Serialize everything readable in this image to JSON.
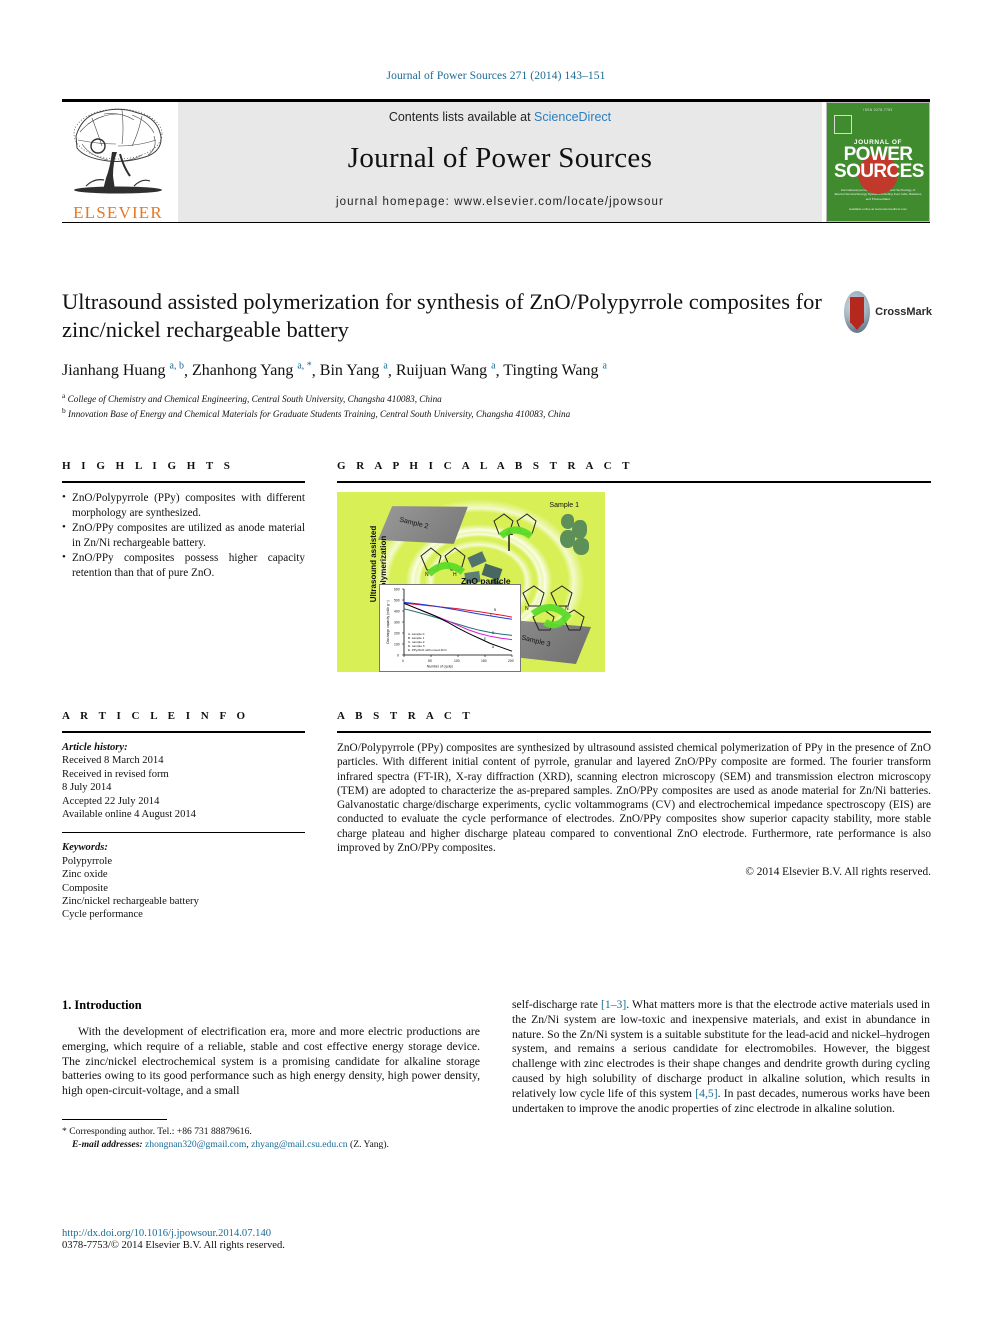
{
  "running_head": "Journal of Power Sources 271 (2014) 143–151",
  "masthead": {
    "contents_prefix": "Contents lists available at ",
    "sciencedirect": "ScienceDirect",
    "journal_name": "Journal of Power Sources",
    "homepage": "journal homepage: www.elsevier.com/locate/jpowsour",
    "publisher_logo_text": "ELSEVIER",
    "cover": {
      "top_line": "ISSN 0378-7753",
      "journal_of": "JOURNAL OF",
      "word1": "POWER",
      "word2": "SOURCES",
      "blurb": "International journal on the Science and Technology of Electrochemical Energy Systems including Fuel Cells, Batteries and Photovoltaics",
      "bottom": "Available online at www.sciencedirect.com"
    }
  },
  "article": {
    "title": "Ultrasound assisted polymerization for synthesis of ZnO/Polypyrrole composites for zinc/nickel rechargeable battery",
    "crossmark_label": "CrossMark",
    "authors": [
      {
        "name": "Jianhang Huang",
        "marks": "a, b"
      },
      {
        "name": "Zhanhong Yang",
        "marks": "a, *"
      },
      {
        "name": "Bin Yang",
        "marks": "a"
      },
      {
        "name": "Ruijuan Wang",
        "marks": "a"
      },
      {
        "name": "Tingting Wang",
        "marks": "a"
      }
    ],
    "affiliations": [
      {
        "mark": "a",
        "text": "College of Chemistry and Chemical Engineering, Central South University, Changsha 410083, China"
      },
      {
        "mark": "b",
        "text": "Innovation Base of Energy and Chemical Materials for Graduate Students Training, Central South University, Changsha 410083, China"
      }
    ]
  },
  "highlights": {
    "heading": "H I G H L I G H T S",
    "items": [
      "ZnO/Polypyrrole (PPy) composites with different morphology are synthesized.",
      "ZnO/PPy composites are utilized as anode material in Zn/Ni rechargeable battery.",
      "ZnO/PPy composites possess higher capacity retention than that of pure ZnO."
    ]
  },
  "graphical_abstract": {
    "heading": "G R A P H I C A L  A B S T R A C T",
    "figure_labels": {
      "vertical": "Ultrasound assisted polymerization",
      "sample1": "Sample 1",
      "sample2": "Sample 2",
      "sample3": "Sample 3",
      "zno": "ZnO particle"
    }
  },
  "chart_data": {
    "type": "line",
    "title": "",
    "xlabel": "Number of cycles",
    "ylabel": "Discharge capacity (mAh g⁻¹)",
    "xlim": [
      0,
      200
    ],
    "ylim": [
      0,
      600
    ],
    "xticks": [
      0,
      50,
      100,
      150,
      200
    ],
    "yticks": [
      0,
      100,
      200,
      300,
      400,
      500,
      600
    ],
    "grid": false,
    "legend_position": "lower-left",
    "legend": [
      {
        "key": "A",
        "label": "sample 0",
        "color": "#000000"
      },
      {
        "key": "B",
        "label": "sample 1",
        "color": "#e8112d"
      },
      {
        "key": "C",
        "label": "sample 2",
        "color": "#1a3fd0"
      },
      {
        "key": "D",
        "label": "sample 3",
        "color": "#1f6f6f"
      },
      {
        "key": "E",
        "label": "PPy/ZnO with mixed ZnO",
        "color": "#d81bd8"
      }
    ],
    "series": [
      {
        "name": "sample 0",
        "color": "#000000",
        "x": [
          0,
          20,
          40,
          60,
          80,
          100,
          120,
          140,
          160,
          180,
          200
        ],
        "values": [
          470,
          430,
          390,
          350,
          300,
          245,
          195,
          150,
          105,
          70,
          35
        ]
      },
      {
        "name": "sample 1",
        "color": "#e8112d",
        "x": [
          0,
          20,
          40,
          60,
          80,
          100,
          120,
          140,
          160,
          180,
          200
        ],
        "values": [
          495,
          488,
          478,
          468,
          458,
          447,
          433,
          420,
          405,
          390,
          372
        ]
      },
      {
        "name": "sample 2",
        "color": "#1a3fd0",
        "x": [
          0,
          20,
          40,
          60,
          80,
          100,
          120,
          140,
          160,
          180,
          200
        ],
        "values": [
          478,
          468,
          455,
          442,
          425,
          408,
          390,
          372,
          355,
          340,
          325
        ]
      },
      {
        "name": "sample 3",
        "color": "#1f6f6f",
        "x": [
          0,
          20,
          40,
          60,
          80,
          100,
          120,
          140,
          160,
          180,
          200
        ],
        "values": [
          420,
          395,
          368,
          340,
          310,
          280,
          250,
          225,
          205,
          190,
          178
        ]
      },
      {
        "name": "PPy/ZnO with mixed ZnO",
        "color": "#d81bd8",
        "x": [
          0,
          20,
          40,
          60,
          80,
          100,
          120,
          140,
          160,
          180,
          200
        ],
        "values": [
          470,
          430,
          392,
          352,
          312,
          270,
          228,
          195,
          170,
          152,
          140
        ]
      }
    ]
  },
  "article_info": {
    "heading": "A R T I C L E  I N F O",
    "history_label": "Article history:",
    "history": [
      "Received 8 March 2014",
      "Received in revised form",
      "8 July 2014",
      "Accepted 22 July 2014",
      "Available online 4 August 2014"
    ],
    "keywords_label": "Keywords:",
    "keywords": [
      "Polypyrrole",
      "Zinc oxide",
      "Composite",
      "Zinc/nickel rechargeable battery",
      "Cycle performance"
    ]
  },
  "abstract": {
    "heading": "A B S T R A C T",
    "text": "ZnO/Polypyrrole (PPy) composites are synthesized by ultrasound assisted chemical polymerization of PPy in the presence of ZnO particles. With different initial content of pyrrole, granular and layered ZnO/PPy composite are formed. The fourier transform infrared spectra (FT-IR), X-ray diffraction (XRD), scanning electron microscopy (SEM) and transmission electron microscopy (TEM) are adopted to characterize the as-prepared samples. ZnO/PPy composites are used as anode material for Zn/Ni batteries. Galvanostatic charge/discharge experiments, cyclic voltammograms (CV) and electrochemical impedance spectroscopy (EIS) are conducted to evaluate the cycle performance of electrodes. ZnO/PPy composites show superior capacity stability, more stable charge plateau and higher discharge plateau compared to conventional ZnO electrode. Furthermore, rate performance is also improved by ZnO/PPy composites.",
    "copyright": "© 2014 Elsevier B.V. All rights reserved."
  },
  "body": {
    "section_heading": "1.  Introduction",
    "left_paragraph": "With the development of electrification era, more and more electric productions are emerging, which require of a reliable, stable and cost effective energy storage device. The zinc/nickel electrochemical system is a promising candidate for alkaline storage batteries owing to its good performance such as high energy density, high power density, high open-circuit-voltage, and a small",
    "right_paragraph_1": "self-discharge rate ",
    "right_ref_1": "[1–3]",
    "right_paragraph_2": ". What matters more is that the electrode active materials used in the Zn/Ni system are low-toxic and inexpensive materials, and exist in abundance in nature. So the Zn/Ni system is a suitable substitute for the lead-acid and nickel–hydrogen system, and remains a serious candidate for electromobiles. However, the biggest challenge with zinc electrodes is their shape changes and dendrite growth during cycling caused by high solubility of discharge product in alkaline solution, which results in relatively low cycle life of this system ",
    "right_ref_2": "[4,5]",
    "right_paragraph_3": ". In past decades, numerous works have been undertaken to improve the anodic properties of zinc electrode in alkaline solution."
  },
  "footnote": {
    "corresponding": "* Corresponding author. Tel.: +86 731 88879616.",
    "email_label": "E-mail addresses:",
    "email1": "zhongnan320@gmail.com",
    "email_sep": ", ",
    "email2": "zhyang@mail.csu.edu.cn",
    "email_suffix": " (Z. Yang)."
  },
  "page_footer": {
    "doi": "http://dx.doi.org/10.1016/j.jpowsour.2014.07.140",
    "issn": "0378-7753/© 2014 Elsevier B.V. All rights reserved."
  },
  "colors": {
    "link": "#1a6b96",
    "elsevier_orange": "#E87722",
    "cover_green": "#3f8b2e",
    "ga_green": "#d8f055"
  }
}
